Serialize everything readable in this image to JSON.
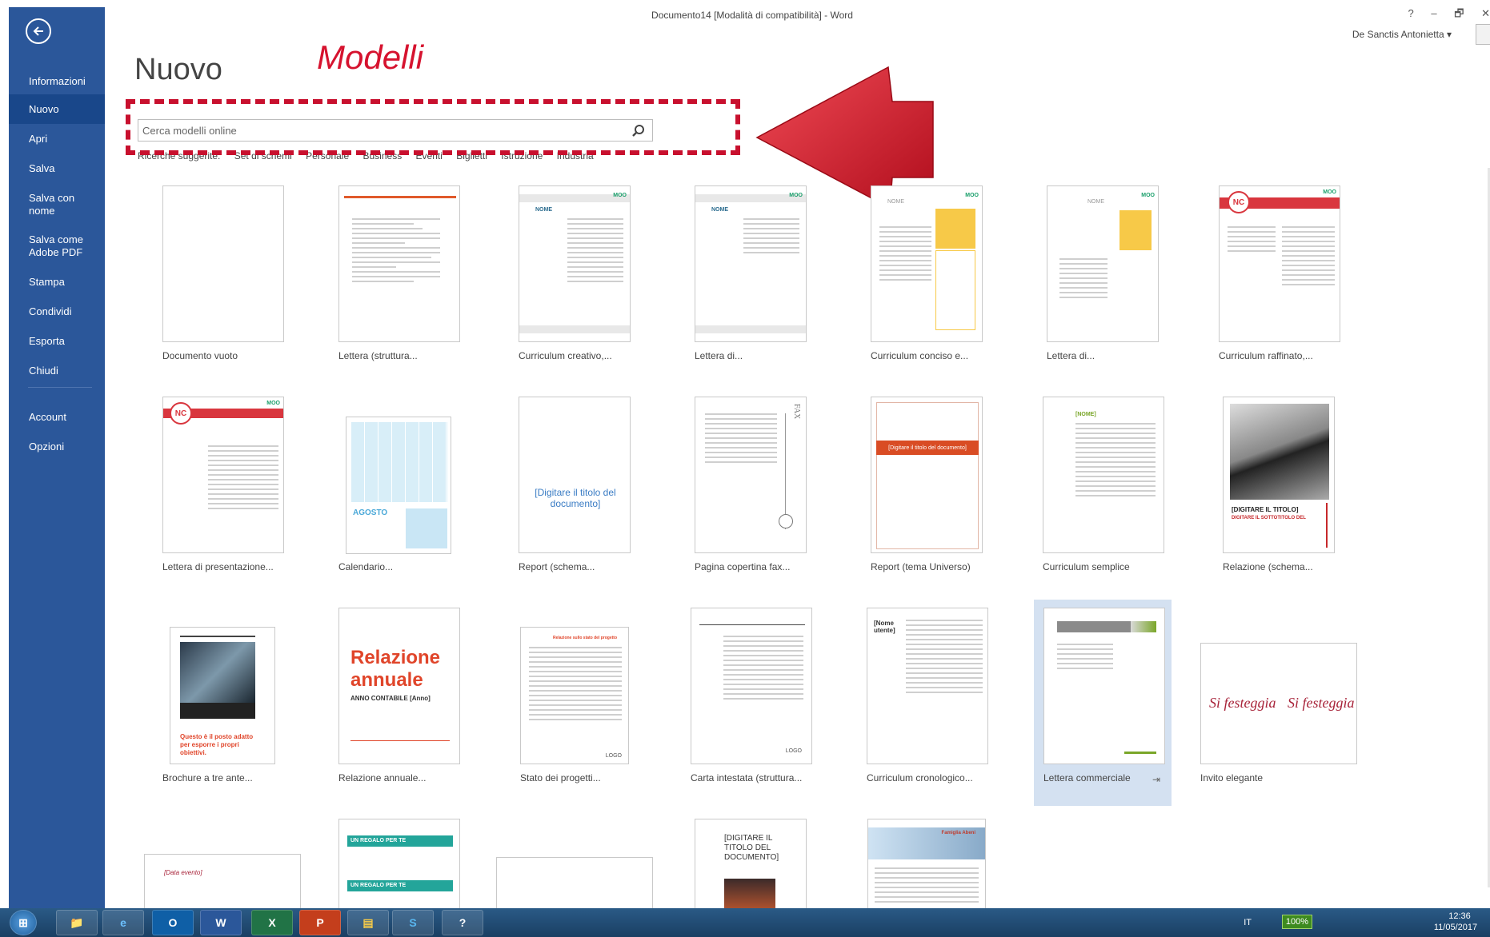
{
  "window": {
    "title": "Documento14 [Modalità di compatibilità] - Word",
    "help_label": "?",
    "minimize_label": "–",
    "restore_label": "🗗",
    "close_label": "✕"
  },
  "user": {
    "name": "De Sanctis Antonietta ▾"
  },
  "sidebar": {
    "items": [
      {
        "label": "Informazioni"
      },
      {
        "label": "Nuovo"
      },
      {
        "label": "Apri"
      },
      {
        "label": "Salva"
      },
      {
        "label": "Salva con\nnome"
      },
      {
        "label": "Salva come\nAdobe PDF"
      },
      {
        "label": "Stampa"
      },
      {
        "label": "Condividi"
      },
      {
        "label": "Esporta"
      },
      {
        "label": "Chiudi"
      },
      {
        "label": "Account"
      },
      {
        "label": "Opzioni"
      }
    ]
  },
  "main": {
    "title": "Nuovo",
    "annotation_label": "Modelli",
    "search": {
      "placeholder": "Cerca modelli online",
      "value": ""
    },
    "suggested_searches": [
      "Ricerche suggerite:",
      "Set di schemi",
      "Personale",
      "Business",
      "Eventi",
      "Biglietti",
      "Istruzione",
      "Industria"
    ]
  },
  "templates": [
    {
      "label": "Documento vuoto"
    },
    {
      "label": "Lettera (struttura..."
    },
    {
      "label": "Curriculum creativo,..."
    },
    {
      "label": "Lettera di..."
    },
    {
      "label": "Curriculum conciso e..."
    },
    {
      "label": "Lettera di..."
    },
    {
      "label": "Curriculum raffinato,..."
    },
    {
      "label": "Lettera di presentazione..."
    },
    {
      "label": "Calendario..."
    },
    {
      "label": "Report (schema..."
    },
    {
      "label": "Pagina copertina fax..."
    },
    {
      "label": "Report (tema Universo)"
    },
    {
      "label": "Curriculum semplice"
    },
    {
      "label": "Relazione (schema..."
    },
    {
      "label": "Brochure a tre ante..."
    },
    {
      "label": "Relazione annuale..."
    },
    {
      "label": "Stato dei progetti..."
    },
    {
      "label": "Carta intestata (struttura..."
    },
    {
      "label": "Curriculum cronologico..."
    },
    {
      "label": "Lettera commerciale"
    },
    {
      "label": "Invito elegante"
    }
  ],
  "thumb_text": {
    "nome": "NOME",
    "nc": "NC",
    "moo": "MOO",
    "agosto": "AGOSTO",
    "report_title": "[Digitare il titolo del documento]",
    "universo_title": "[Digitare il titolo del documento]",
    "relazione_title": "[DIGITARE IL TITOLO]",
    "relazione_sub": "DIGITARE IL SOTTOTITOLO DEL",
    "brochure_text": "Questo è il posto adatto per esporre i propri obiettivi.",
    "annual_title": "Relazione annuale",
    "annual_sub": "ANNO CONTABILE [Anno]",
    "stato_title": "Relazione sullo stato del progetto",
    "logo": "LOGO",
    "nome_utente": "[Nome utente]",
    "festeggia1": "Si festeggia",
    "festeggia2": "Si festeggia",
    "fax": "FAX",
    "nome_bracket": "[NOME]",
    "regalo": "UN REGALO PER TE",
    "titolo_doc": "[DIGITARE IL TITOLO DEL DOCUMENTO]",
    "famiglia": "Famiglia Abeni",
    "data": "[Data evento]"
  },
  "taskbar": {
    "apps": [
      {
        "icon": "windows-start-icon",
        "label": "⊞"
      },
      {
        "icon": "file-explorer-icon",
        "label": "📁"
      },
      {
        "icon": "internet-explorer-icon",
        "label": "e"
      },
      {
        "icon": "outlook-icon",
        "label": "O"
      },
      {
        "icon": "word-icon",
        "label": "W"
      },
      {
        "icon": "excel-icon",
        "label": "X"
      },
      {
        "icon": "powerpoint-icon",
        "label": "P"
      },
      {
        "icon": "folder-icon",
        "label": "▤"
      },
      {
        "icon": "skype-icon",
        "label": "S"
      },
      {
        "icon": "help-icon",
        "label": "?"
      }
    ],
    "language": "IT",
    "battery": "100%",
    "time": "12:36",
    "date": "11/05/2017"
  },
  "colors": {
    "sidebar": "#2b579a",
    "annotation": "#c8102e",
    "word_blue": "#2b579a"
  }
}
